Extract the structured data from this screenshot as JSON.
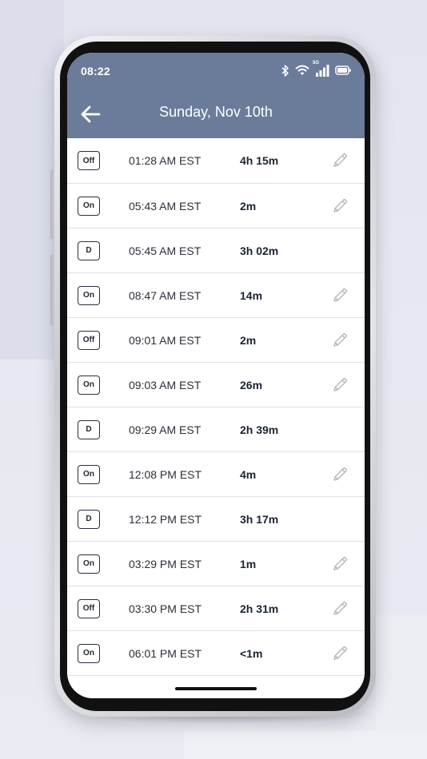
{
  "status_bar": {
    "time": "08:22",
    "icons": [
      "bluetooth-icon",
      "wifi-icon",
      "signal-icon",
      "battery-icon"
    ],
    "signal_label": "5G"
  },
  "header": {
    "title": "Sunday, Nov 10th",
    "back_icon": "arrow-left-icon",
    "background": "#6b7c9a"
  },
  "entries": [
    {
      "status": "Off",
      "time": "01:28 AM EST",
      "duration": "4h 15m",
      "editable": true
    },
    {
      "status": "On",
      "time": "05:43 AM EST",
      "duration": "2m",
      "editable": true
    },
    {
      "status": "D",
      "time": "05:45 AM EST",
      "duration": "3h 02m",
      "editable": false
    },
    {
      "status": "On",
      "time": "08:47 AM EST",
      "duration": "14m",
      "editable": true
    },
    {
      "status": "Off",
      "time": "09:01 AM EST",
      "duration": "2m",
      "editable": true
    },
    {
      "status": "On",
      "time": "09:03 AM EST",
      "duration": "26m",
      "editable": true
    },
    {
      "status": "D",
      "time": "09:29 AM EST",
      "duration": "2h 39m",
      "editable": false
    },
    {
      "status": "On",
      "time": "12:08 PM EST",
      "duration": "4m",
      "editable": true
    },
    {
      "status": "D",
      "time": "12:12 PM EST",
      "duration": "3h 17m",
      "editable": false
    },
    {
      "status": "On",
      "time": "03:29 PM EST",
      "duration": "1m",
      "editable": true
    },
    {
      "status": "Off",
      "time": "03:30 PM EST",
      "duration": "2h 31m",
      "editable": true
    },
    {
      "status": "On",
      "time": "06:01 PM EST",
      "duration": "<1m",
      "editable": true
    }
  ],
  "edit_icon": "pencil-icon"
}
